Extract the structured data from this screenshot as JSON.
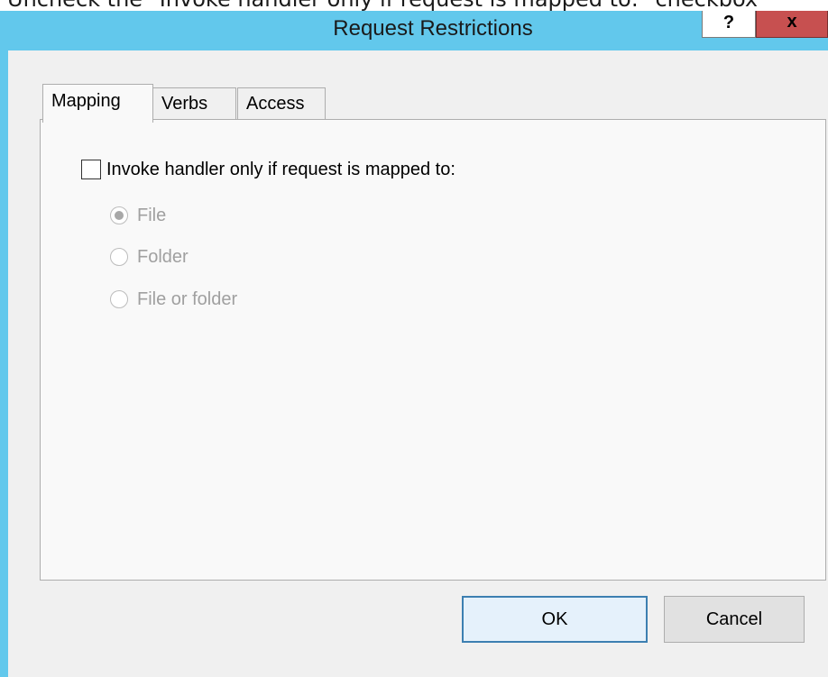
{
  "caption": "Uncheck the \"Invoke handler only if request is mapped to:\" checkbox",
  "dialog": {
    "title": "Request Restrictions",
    "help_label": "?",
    "close_label": "x",
    "tabs": [
      {
        "label": "Mapping",
        "active": true
      },
      {
        "label": "Verbs",
        "active": false
      },
      {
        "label": "Access",
        "active": false
      }
    ],
    "mapping": {
      "checkbox_label": "Invoke handler only if request is mapped to:",
      "checkbox_checked": false,
      "options": [
        {
          "label": "File",
          "selected": true,
          "enabled": false
        },
        {
          "label": "Folder",
          "selected": false,
          "enabled": false
        },
        {
          "label": "File or folder",
          "selected": false,
          "enabled": false
        }
      ]
    },
    "buttons": {
      "ok_label": "OK",
      "cancel_label": "Cancel"
    }
  },
  "colors": {
    "title_bar": "#62c8ec",
    "close_button": "#c75050",
    "dialog_background": "#f0f0f0",
    "tab_panel": "#f9f9f9",
    "disabled_text": "#a0a0a0",
    "default_button_border": "#3c7fb1"
  }
}
